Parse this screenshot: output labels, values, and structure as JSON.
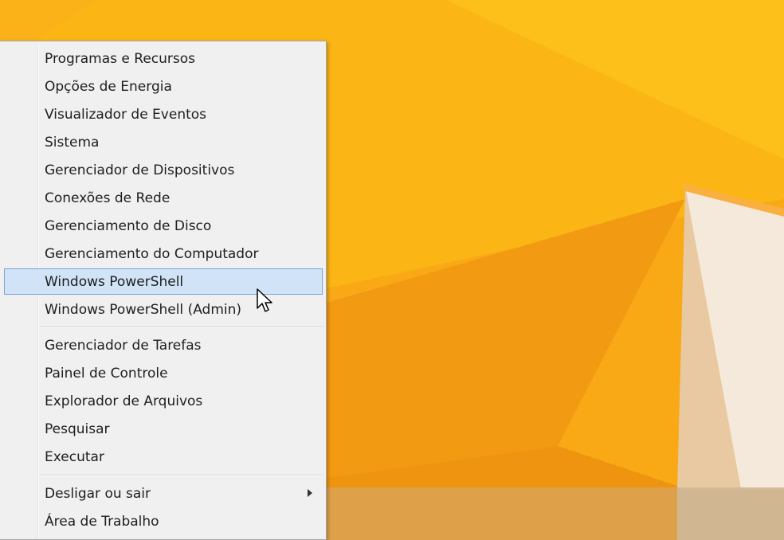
{
  "colors": {
    "wallpaper_light": "#fcbb12",
    "wallpaper_mid": "#f8a514",
    "wallpaper_dark": "#ee8e10",
    "menu_bg": "#f0f0f0",
    "highlight_bg": "#d1e4f7",
    "highlight_border": "#7aa4cf"
  },
  "menu": {
    "group1": [
      {
        "label": "Programas e Recursos"
      },
      {
        "label": "Opções de Energia"
      },
      {
        "label": "Visualizador de Eventos"
      },
      {
        "label": "Sistema"
      },
      {
        "label": "Gerenciador de Dispositivos"
      },
      {
        "label": "Conexões de Rede"
      },
      {
        "label": "Gerenciamento de Disco"
      },
      {
        "label": "Gerenciamento do Computador"
      },
      {
        "label": "Windows PowerShell",
        "highlighted": true
      },
      {
        "label": "Windows PowerShell (Admin)"
      }
    ],
    "group2": [
      {
        "label": "Gerenciador de Tarefas"
      },
      {
        "label": "Painel de Controle"
      },
      {
        "label": "Explorador de Arquivos"
      },
      {
        "label": "Pesquisar"
      },
      {
        "label": "Executar"
      }
    ],
    "group3": [
      {
        "label": "Desligar ou sair",
        "has_submenu": true,
        "submenu_icon": "chevron-right-icon"
      },
      {
        "label": "Área de Trabalho"
      }
    ]
  },
  "cursor_icon": "arrow-cursor-icon"
}
